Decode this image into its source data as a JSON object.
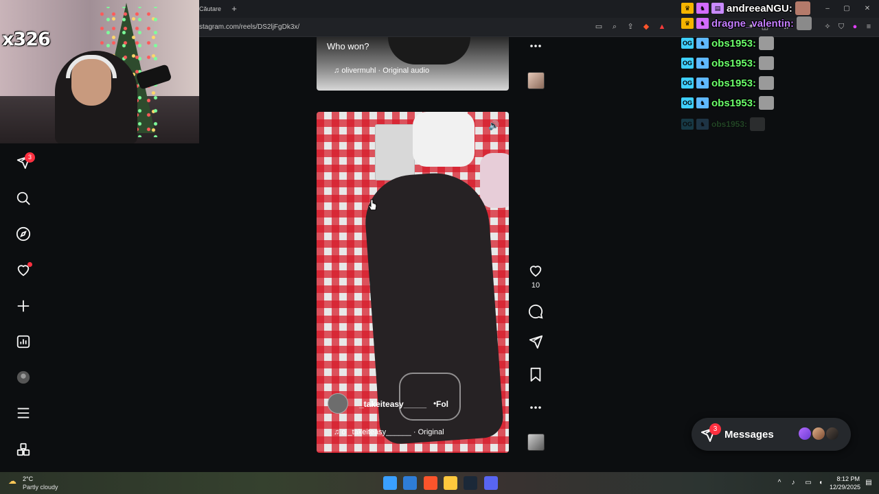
{
  "browser": {
    "tab_label": "Căutare",
    "new_tab": "+",
    "url": "stagram.com/reels/DS2ljFgDk3x/",
    "window_controls": [
      "–",
      "▢",
      "✕"
    ]
  },
  "webcam": {
    "counter": "x326"
  },
  "sidebar": {
    "items": [
      {
        "name": "direct-messages",
        "icon": "paper-plane-icon",
        "badge": "3"
      },
      {
        "name": "search",
        "icon": "search-icon"
      },
      {
        "name": "explore",
        "icon": "compass-icon"
      },
      {
        "name": "notifications",
        "icon": "heart-icon",
        "has_dot": true
      },
      {
        "name": "create",
        "icon": "plus-icon"
      },
      {
        "name": "dashboard",
        "icon": "insights-icon"
      },
      {
        "name": "profile",
        "icon": "avatar-icon"
      },
      {
        "name": "more",
        "icon": "hamburger-icon"
      },
      {
        "name": "also-from-meta",
        "icon": "grid-icon"
      }
    ]
  },
  "reels": [
    {
      "caption": "Who won?",
      "audio": "olivermuhl · Original audio"
    },
    {
      "username": "_takeiteasy_____",
      "follow_sep": "•",
      "follow_label": "Fol",
      "audio": "o _takeiteasy______ · Original"
    }
  ],
  "actions": {
    "like_count": "10",
    "icons": [
      "more-icon",
      "heart-icon",
      "comment-icon",
      "share-icon",
      "bookmark-icon",
      "more-icon"
    ]
  },
  "chat": [
    {
      "name": "andreeaNGU:",
      "color": "#ffffff",
      "badge": "crown"
    },
    {
      "name": "dragne_valentin:",
      "color": "#c47eff",
      "badge": "crown"
    },
    {
      "name": "obs1953:",
      "color": "#6bff6b",
      "badge": "OG"
    },
    {
      "name": "obs1953:",
      "color": "#6bff6b",
      "badge": "OG"
    },
    {
      "name": "obs1953:",
      "color": "#6bff6b",
      "badge": "OG"
    },
    {
      "name": "obs1953:",
      "color": "#6bff6b",
      "badge": "OG"
    },
    {
      "name": "obs1953:",
      "color": "#6bff6b",
      "badge": "OG",
      "faded": true
    }
  ],
  "messages": {
    "label": "Messages",
    "badge": "3"
  },
  "taskbar": {
    "weather_temp": "2°C",
    "weather_desc": "Partly cloudy",
    "time": "8:12 PM",
    "date": "12/29/2025"
  },
  "colors": {
    "accent_red": "#ff3040",
    "background": "#0c0e10"
  }
}
